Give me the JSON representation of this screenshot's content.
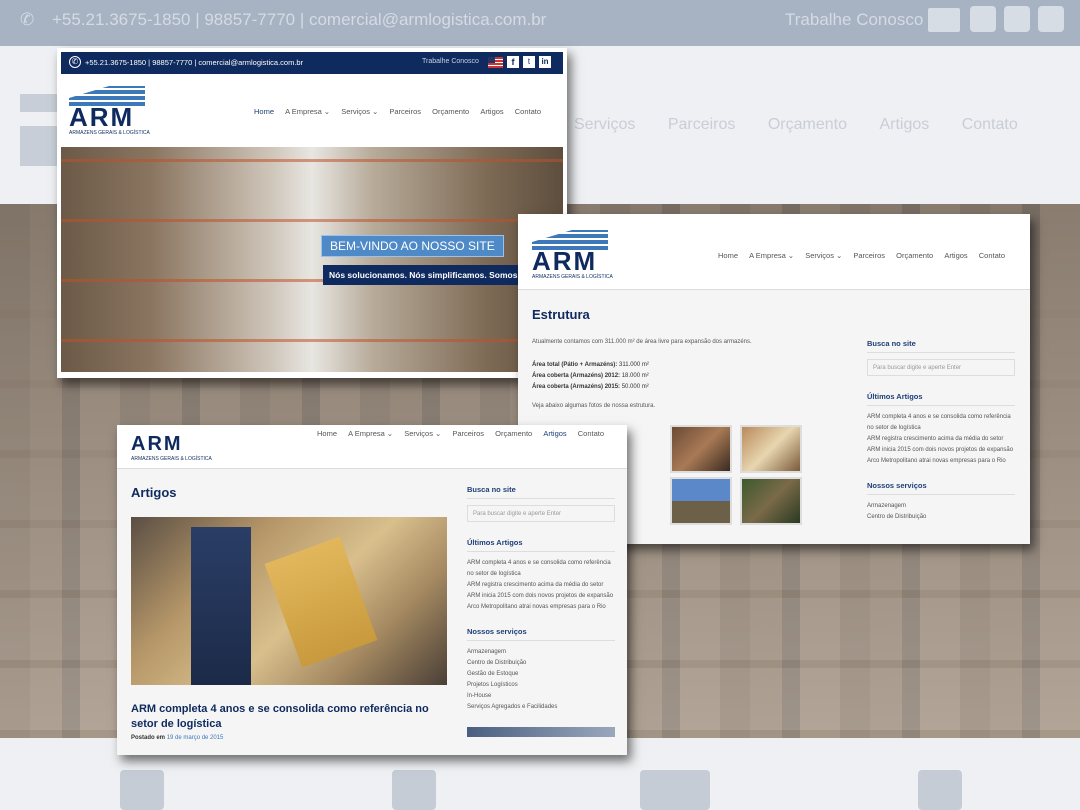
{
  "contact": {
    "phones": "+55.21.3675-1850 | 98857-7770 | comercial@armlogistica.com.br",
    "work_with_us": "Trabalhe Conosco"
  },
  "brand": {
    "name": "ARM",
    "tagline": "ARMAZENS GERAIS & LOGÍSTICA"
  },
  "nav": [
    "Home",
    "A Empresa",
    "Serviços",
    "Parceiros",
    "Orçamento",
    "Artigos",
    "Contato"
  ],
  "background_nav": [
    "Serviços",
    "Parceiros",
    "Orçamento",
    "Artigos",
    "Contato"
  ],
  "home": {
    "welcome": "BEM-VINDO AO NOSSO SITE",
    "slogan": "Nós solucionamos. Nós simplificamos. Somos ARM"
  },
  "estrutura": {
    "title": "Estrutura",
    "intro": "Atualmente contamos com 311.000 m² de área livre para expansão dos armazéns.",
    "facts": [
      {
        "label": "Área total (Pátio + Armazéns):",
        "value": "311.000 m²"
      },
      {
        "label": "Área coberta (Armazéns) 2012:",
        "value": "18.000 m²"
      },
      {
        "label": "Área coberta (Armazéns) 2015:",
        "value": "50.000 m²"
      }
    ],
    "photos_note": "Veja abaixo algumas fotos de nossa estrutura."
  },
  "sidebar": {
    "search_title": "Busca no site",
    "search_placeholder": "Para buscar digite e aperte Enter",
    "latest_title": "Últimos Artigos",
    "latest": [
      "ARM completa 4 anos e se consolida como referência no setor de logística",
      "ARM registra crescimento acima da média do setor",
      "ARM inicia 2015 com dois novos projetos de expansão",
      "Arco Metropolitano atrai novas empresas para o Rio"
    ],
    "services_title": "Nossos serviços",
    "services": [
      "Armazenagem",
      "Centro de Distribuição",
      "Gestão de Estoque",
      "Projetos Logísticos",
      "In-House",
      "Serviços Agregados e Facilidades"
    ]
  },
  "artigos": {
    "title": "Artigos",
    "post_title": "ARM completa 4 anos e se consolida como referência no setor de logística",
    "posted_label": "Postado em",
    "posted_date": "19 de março de 2015"
  },
  "colors": {
    "navy": "#0e2a5e",
    "accent": "#3d78b8",
    "link": "#1c3f78"
  }
}
